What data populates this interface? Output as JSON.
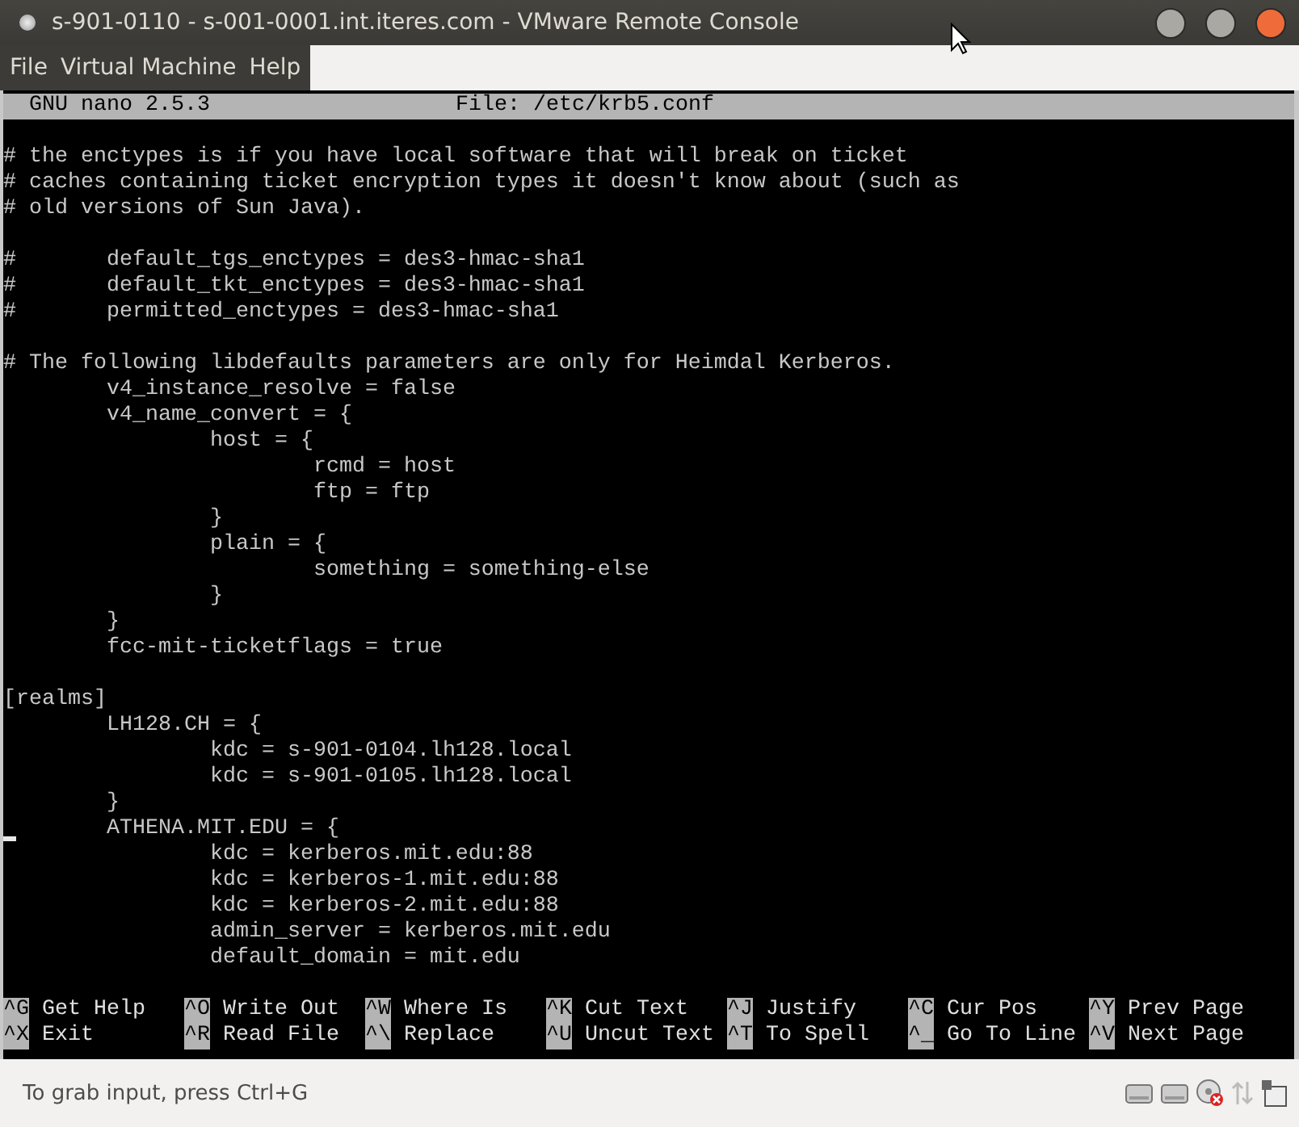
{
  "window": {
    "title": "s-901-0110 - s-001-0001.int.iteres.com - VMware Remote Console"
  },
  "menu": [
    "File",
    "Virtual Machine",
    "Help"
  ],
  "nano": {
    "version_label": "GNU nano 2.5.3",
    "file_label": "File: /etc/krb5.conf",
    "blocks": [
      [
        {
          "text": "# the enctypes is if you have local software that will break on ticket",
          "cursor": false
        },
        {
          "text": "# caches containing ticket encryption types it doesn't know about (such as",
          "cursor": false
        },
        {
          "text": "# old versions of Sun Java).",
          "cursor": false
        }
      ],
      [
        {
          "text": "#       default_tgs_enctypes = des3-hmac-sha1",
          "cursor": false
        },
        {
          "text": "#       default_tkt_enctypes = des3-hmac-sha1",
          "cursor": false
        },
        {
          "text": "#       permitted_enctypes = des3-hmac-sha1",
          "cursor": false
        }
      ],
      [
        {
          "text": "# The following libdefaults parameters are only for Heimdal Kerberos.",
          "cursor": false
        },
        {
          "text": "        v4_instance_resolve = false",
          "cursor": false
        },
        {
          "text": "        v4_name_convert = {",
          "cursor": false
        },
        {
          "text": "                host = {",
          "cursor": false
        },
        {
          "text": "                        rcmd = host",
          "cursor": false
        },
        {
          "text": "                        ftp = ftp",
          "cursor": false
        },
        {
          "text": "                }",
          "cursor": false
        },
        {
          "text": "                plain = {",
          "cursor": false
        },
        {
          "text": "                        something = something-else",
          "cursor": false
        },
        {
          "text": "                }",
          "cursor": false
        },
        {
          "text": "        }",
          "cursor": false
        },
        {
          "text": "        fcc-mit-ticketflags = true",
          "cursor": false
        }
      ],
      [
        {
          "text": "[realms]",
          "cursor": false
        },
        {
          "text": "        LH128.CH = {",
          "cursor": false
        },
        {
          "text": "                kdc = s-901-0104.lh128.local",
          "cursor": false
        },
        {
          "text": "                kdc = s-901-0105.lh128.local",
          "cursor": false
        },
        {
          "text": "        }",
          "cursor": false
        },
        {
          "text": "        ATHENA.MIT.EDU = {",
          "cursor": true
        },
        {
          "text": "                kdc = kerberos.mit.edu:88",
          "cursor": false
        },
        {
          "text": "                kdc = kerberos-1.mit.edu:88",
          "cursor": false
        },
        {
          "text": "                kdc = kerberos-2.mit.edu:88",
          "cursor": false
        },
        {
          "text": "                admin_server = kerberos.mit.edu",
          "cursor": false
        },
        {
          "text": "                default_domain = mit.edu",
          "cursor": false
        }
      ]
    ],
    "shortcut_rows": [
      [
        {
          "key": "^G",
          "label": "Get Help"
        },
        {
          "key": "^O",
          "label": "Write Out"
        },
        {
          "key": "^W",
          "label": "Where Is"
        },
        {
          "key": "^K",
          "label": "Cut Text"
        },
        {
          "key": "^J",
          "label": "Justify"
        },
        {
          "key": "^C",
          "label": "Cur Pos"
        },
        {
          "key": "^Y",
          "label": "Prev Page"
        }
      ],
      [
        {
          "key": "^X",
          "label": "Exit"
        },
        {
          "key": "^R",
          "label": "Read File"
        },
        {
          "key": "^\\",
          "label": "Replace"
        },
        {
          "key": "^U",
          "label": "Uncut Text"
        },
        {
          "key": "^T",
          "label": "To Spell"
        },
        {
          "key": "^_",
          "label": "Go To Line"
        },
        {
          "key": "^V",
          "label": "Next Page"
        }
      ]
    ]
  },
  "status_bar": {
    "text": "To grab input, press Ctrl+G"
  }
}
